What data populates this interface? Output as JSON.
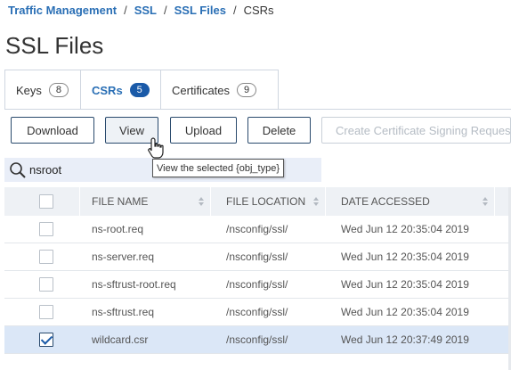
{
  "breadcrumb": {
    "items": [
      "Traffic Management",
      "SSL",
      "SSL Files"
    ],
    "separator": "/",
    "current": "CSRs"
  },
  "page_title": "SSL Files",
  "tabs": [
    {
      "label": "Keys",
      "count": "8",
      "active": false
    },
    {
      "label": "CSRs",
      "count": "5",
      "active": true
    },
    {
      "label": "Certificates",
      "count": "9",
      "active": false
    }
  ],
  "toolbar": {
    "download": "Download",
    "view": "View",
    "upload": "Upload",
    "delete": "Delete",
    "create_csr": "Create Certificate Signing Request"
  },
  "tooltip": "View the selected {obj_type}",
  "search": {
    "value": "nsroot",
    "icon": "search-icon"
  },
  "table": {
    "columns": [
      "FILE NAME",
      "FILE LOCATION",
      "DATE ACCESSED"
    ],
    "rows": [
      {
        "name": "ns-root.req",
        "location": "/nsconfig/ssl/",
        "date": "Wed Jun 12 20:35:04 2019",
        "selected": false
      },
      {
        "name": "ns-server.req",
        "location": "/nsconfig/ssl/",
        "date": "Wed Jun 12 20:35:04 2019",
        "selected": false
      },
      {
        "name": "ns-sftrust-root.req",
        "location": "/nsconfig/ssl/",
        "date": "Wed Jun 12 20:35:04 2019",
        "selected": false
      },
      {
        "name": "ns-sftrust.req",
        "location": "/nsconfig/ssl/",
        "date": "Wed Jun 12 20:35:04 2019",
        "selected": false
      },
      {
        "name": "wildcard.csr",
        "location": "/nsconfig/ssl/",
        "date": "Wed Jun 12 20:37:49 2019",
        "selected": true
      }
    ]
  },
  "colors": {
    "accent": "#1a5aa8",
    "link": "#2a6fb5",
    "selected_row": "#dbe7f7",
    "header_bg": "#eef1f5"
  }
}
